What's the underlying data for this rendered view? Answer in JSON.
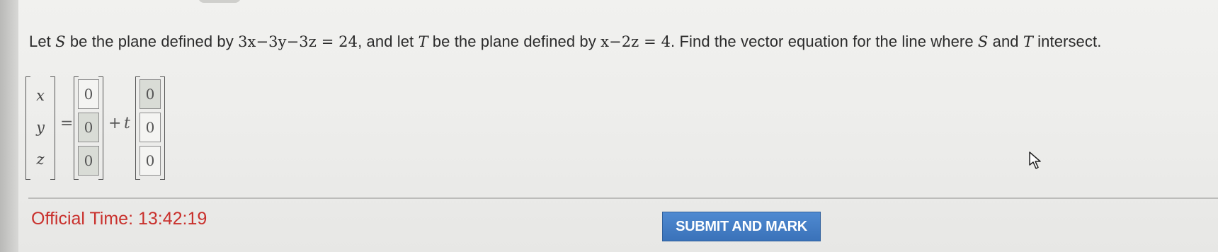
{
  "question": {
    "part1": "Let ",
    "S": "S",
    "part2": " be the plane defined by ",
    "eq1": "3x−3y−3z = 24",
    "part3": ", and let ",
    "T": "T",
    "part4": " be the plane defined by ",
    "eq2": "x−2z = 4",
    "part5": ". Find the vector equation for the line where ",
    "S2": "S",
    "part6": " and ",
    "T2": "T",
    "part7": " intersect."
  },
  "vector_equation": {
    "lhs": [
      "x",
      "y",
      "z"
    ],
    "equals": "=",
    "point_inputs": [
      "0",
      "0",
      "0"
    ],
    "plus": "+",
    "parameter": "t",
    "direction_inputs": [
      "0",
      "0",
      "0"
    ]
  },
  "timer": {
    "label": "Official Time:",
    "value": "13:42:19"
  },
  "buttons": {
    "submit_label": "SUBMIT AND MARK"
  },
  "colors": {
    "timer_text": "#c9302c",
    "button_bg": "#4a84cc",
    "input_highlight": "#d9dcd6"
  }
}
